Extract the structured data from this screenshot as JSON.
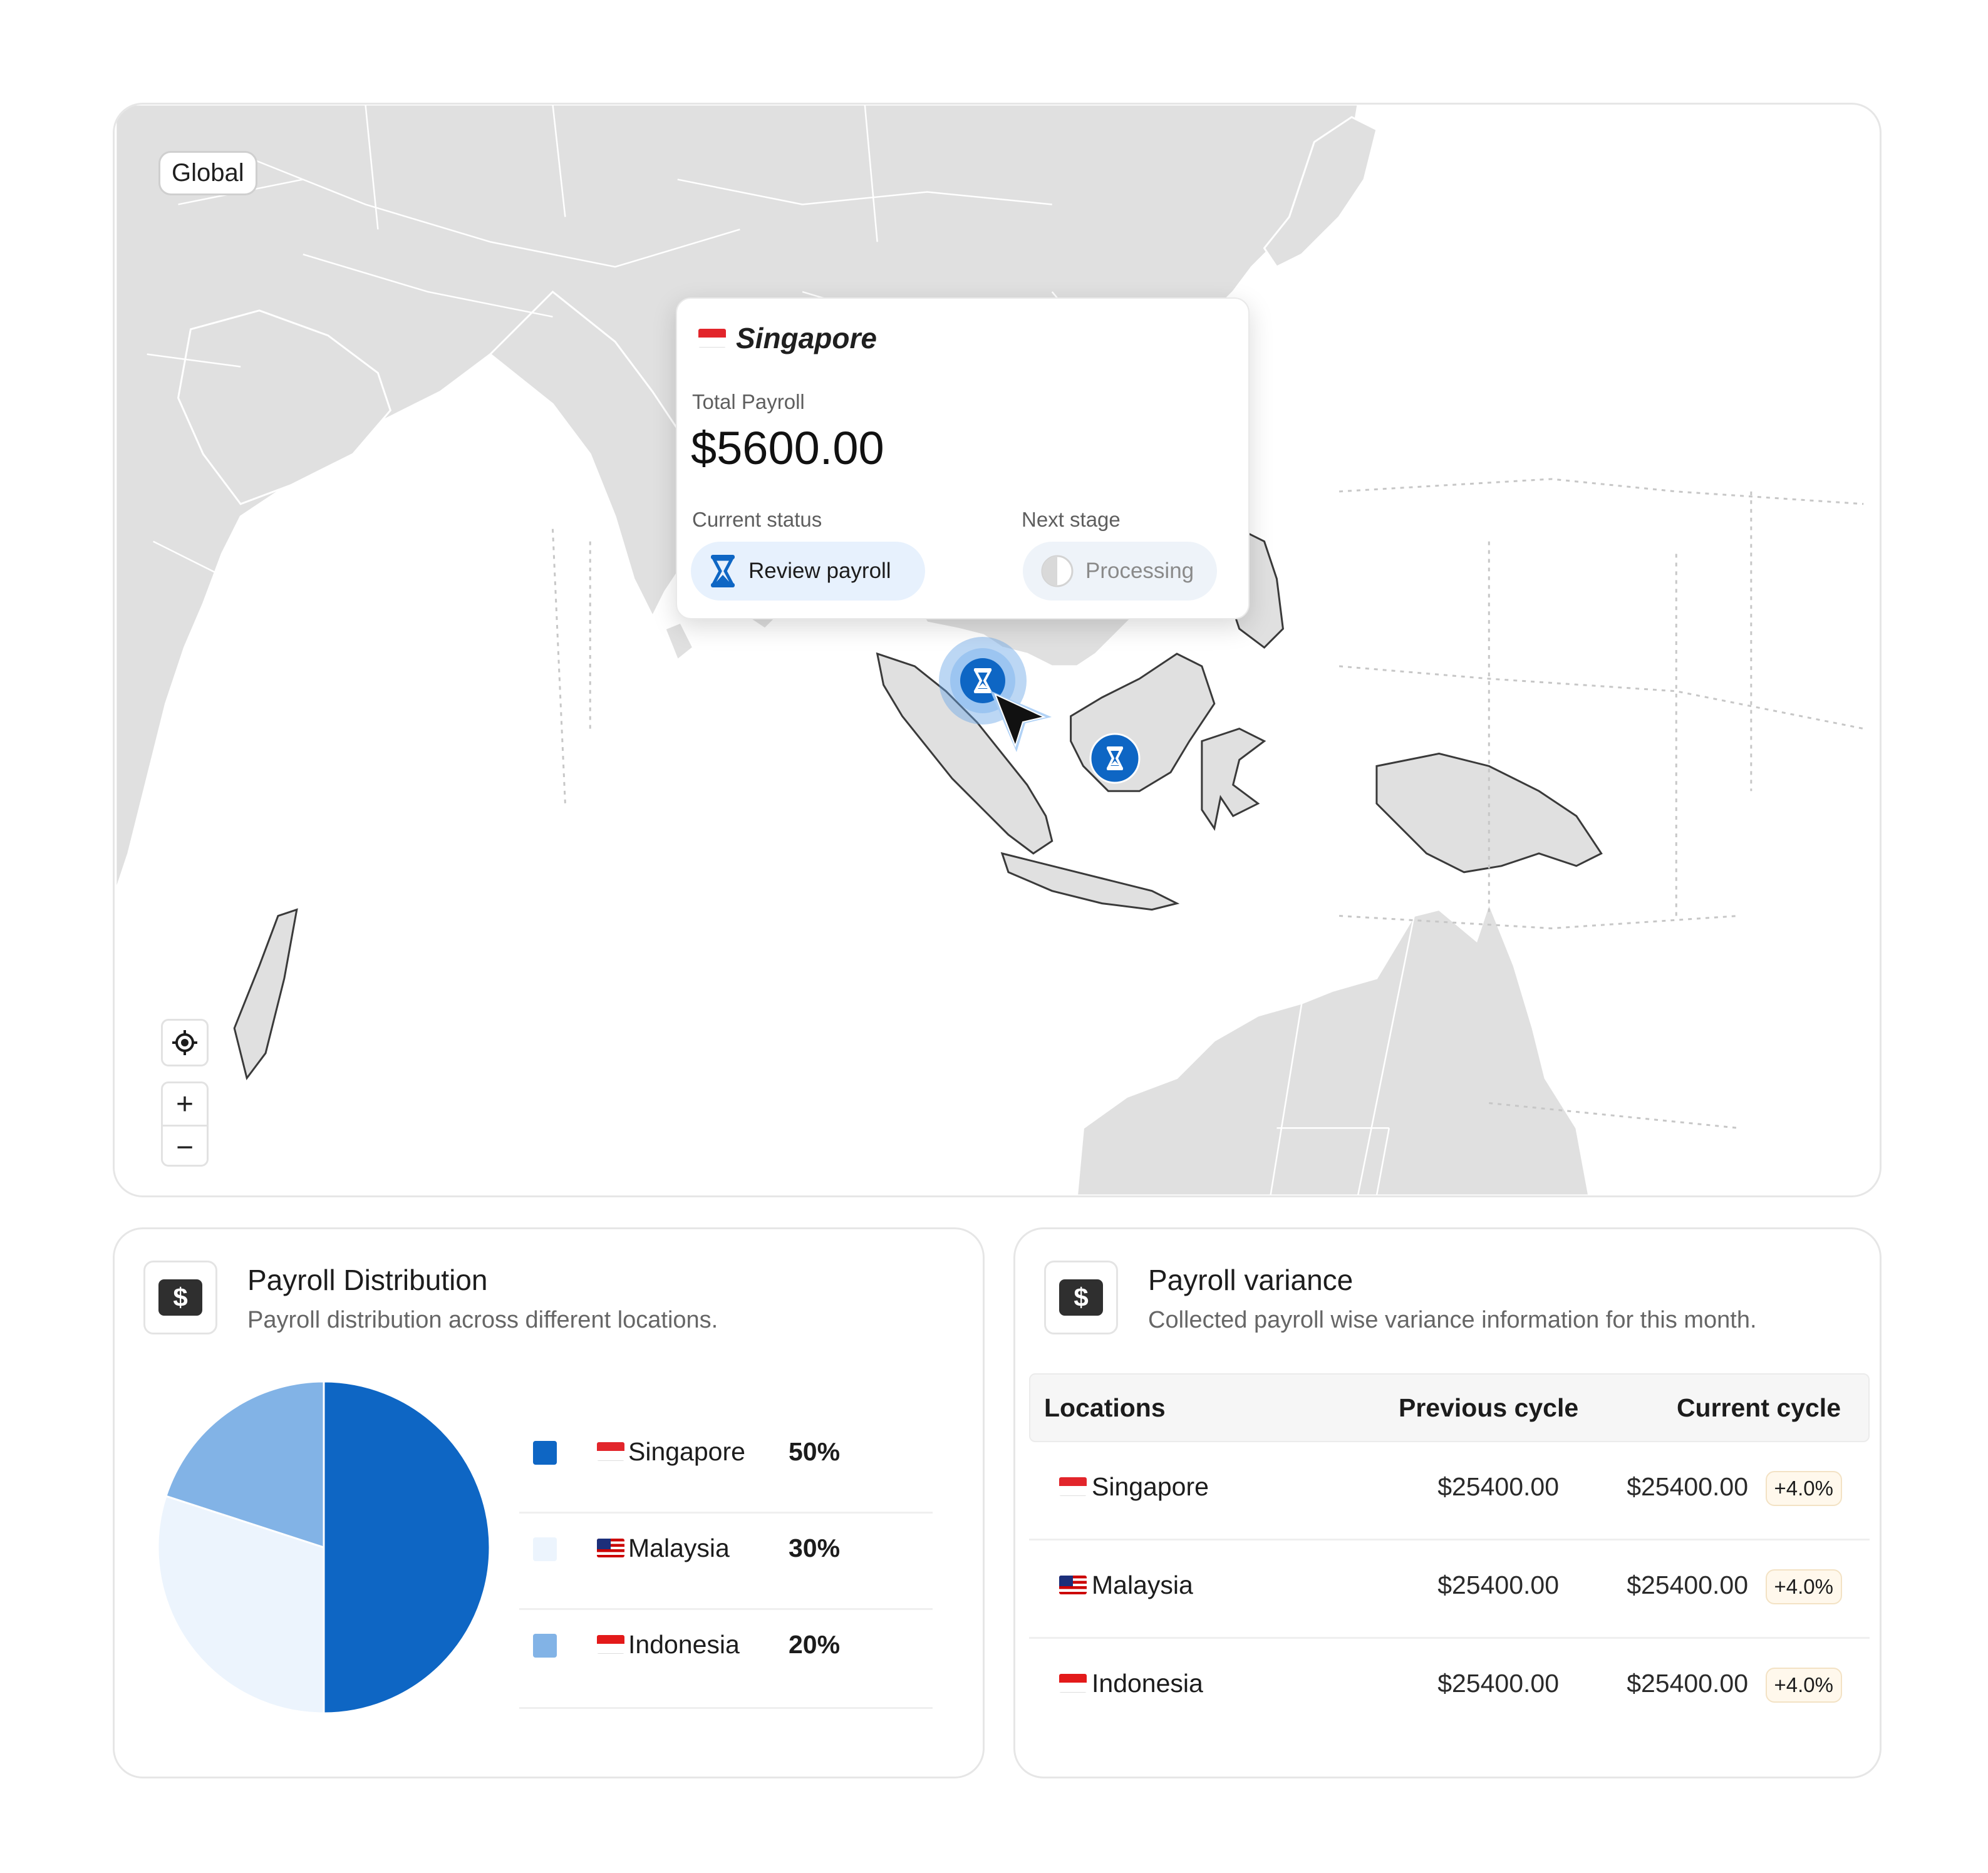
{
  "map": {
    "region_chip": "Global",
    "controls": {
      "locate_icon": "locate-icon",
      "zoom_in": "+",
      "zoom_out": "−"
    },
    "popup": {
      "location": "Singapore",
      "total_label": "Total Payroll",
      "total_value": "$5600.00",
      "status_label": "Current status",
      "status_value": "Review payroll",
      "next_label": "Next stage",
      "next_value": "Processing"
    }
  },
  "distribution": {
    "title": "Payroll Distribution",
    "subtitle": "Payroll distribution across different locations.",
    "items": [
      {
        "name": "Singapore",
        "pct": "50%",
        "color": "#0e66c4"
      },
      {
        "name": "Malaysia",
        "pct": "30%",
        "color": "#ecf4fd"
      },
      {
        "name": "Indonesia",
        "pct": "20%",
        "color": "#82b3e6"
      }
    ]
  },
  "chart_data": {
    "type": "pie",
    "categories": [
      "Singapore",
      "Malaysia",
      "Indonesia"
    ],
    "values": [
      50,
      30,
      20
    ],
    "colors": [
      "#0e66c4",
      "#ecf4fd",
      "#82b3e6"
    ]
  },
  "variance": {
    "title": "Payroll variance",
    "subtitle": "Collected payroll wise variance information for this month.",
    "headers": {
      "location": "Locations",
      "previous": "Previous cycle",
      "current": "Current cycle"
    },
    "rows": [
      {
        "name": "Singapore",
        "previous": "$25400.00",
        "current": "$25400.00",
        "change": "+4.0%"
      },
      {
        "name": "Malaysia",
        "previous": "$25400.00",
        "current": "$25400.00",
        "change": "+4.0%"
      },
      {
        "name": "Indonesia",
        "previous": "$25400.00",
        "current": "$25400.00",
        "change": "+4.0%"
      }
    ]
  },
  "colors": {
    "accent": "#0e66c4",
    "pill_bg": "#e7f1fd",
    "badge_bg": "#fff8ec"
  }
}
